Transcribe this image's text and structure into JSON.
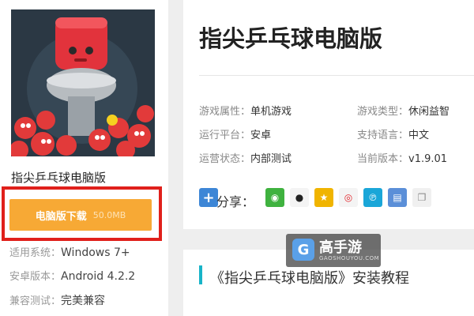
{
  "left": {
    "game_name": "指尖乒乓球电脑版",
    "download_label": "电脑版下载",
    "download_size": "50.0MB",
    "specs": [
      {
        "key": "适用系统：",
        "value": "Windows 7+"
      },
      {
        "key": "安卓版本：",
        "value": "Android 4.2.2"
      },
      {
        "key": "兼容测试：",
        "value": "完美兼容"
      }
    ]
  },
  "right": {
    "title": "指尖乒乓球电脑版",
    "info": {
      "attr_key": "游戏属性：",
      "attr_value": "单机游戏",
      "type_key": "游戏类型：",
      "type_value": "休闲益智",
      "platform_key": "运行平台：",
      "platform_value": "安卓",
      "lang_key": "支持语言：",
      "lang_value": "中文",
      "status_key": "运营状态：",
      "status_value": "内部测试",
      "version_key": "当前版本：",
      "version_value": "v1.9.01"
    },
    "share_label": "分享：",
    "share_icons": [
      "add-icon",
      "wechat-icon",
      "qq-icon",
      "qzone-icon",
      "weibo-icon",
      "tencent-weibo-icon",
      "print-icon",
      "copy-icon"
    ],
    "tutorial_title": "《指尖乒乓球电脑版》安装教程"
  },
  "watermark": {
    "logo": "G",
    "name": "高手游",
    "url": "GAOSHOUYOU.COM"
  },
  "colors": {
    "download_button": "#f7a935",
    "highlight_frame": "#e0201b",
    "accent": "#18b4c8"
  }
}
